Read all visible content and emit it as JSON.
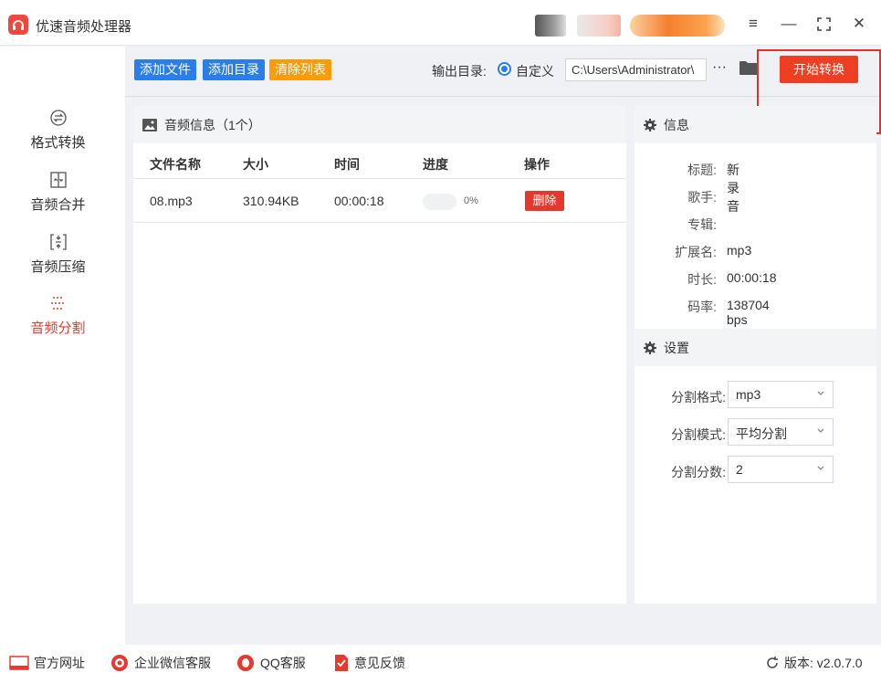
{
  "app": {
    "title": "优速音频处理器"
  },
  "colors": {
    "accent_red": "#ee3f23",
    "blue": "#2b7de9",
    "orange": "#f99c08"
  },
  "window_controls": {
    "menu": "≡",
    "minimize": "—",
    "maximize": "⛶",
    "close": "✕"
  },
  "sidebar": {
    "items": [
      {
        "label": "格式转换",
        "icon": "convert-icon"
      },
      {
        "label": "音频合并",
        "icon": "merge-icon"
      },
      {
        "label": "音频压缩",
        "icon": "compress-icon"
      },
      {
        "label": "音频分割",
        "icon": "split-icon",
        "active": true
      }
    ]
  },
  "toolbar": {
    "add_file": "添加文件",
    "add_dir": "添加目录",
    "clear_list": "清除列表",
    "output_label": "输出目录:",
    "custom_label": "自定义",
    "output_path": "C:\\Users\\Administrator\\",
    "more": "···",
    "start": "开始转换"
  },
  "audio_panel": {
    "title": "音频信息（1个）",
    "columns": [
      "文件名称",
      "大小",
      "时间",
      "进度",
      "操作"
    ],
    "rows": [
      {
        "name": "08.mp3",
        "size": "310.94KB",
        "time": "00:00:18",
        "progress": "0%",
        "action": "删除"
      }
    ]
  },
  "info_panel": {
    "title": "信息",
    "fields": [
      {
        "key": "标题:",
        "value": "新录音"
      },
      {
        "key": "歌手:",
        "value": ""
      },
      {
        "key": "专辑:",
        "value": ""
      },
      {
        "key": "扩展名:",
        "value": "mp3"
      },
      {
        "key": "时长:",
        "value": "00:00:18"
      },
      {
        "key": "码率:",
        "value": "138704 bps"
      }
    ]
  },
  "settings_panel": {
    "title": "设置",
    "fields": [
      {
        "label": "分割格式:",
        "value": "mp3"
      },
      {
        "label": "分割模式:",
        "value": "平均分割"
      },
      {
        "label": "分割分数:",
        "value": "2"
      }
    ]
  },
  "footer": {
    "website": "官方网址",
    "wechat": "企业微信客服",
    "qq": "QQ客服",
    "feedback": "意见反馈",
    "version": "版本: v2.0.7.0"
  }
}
